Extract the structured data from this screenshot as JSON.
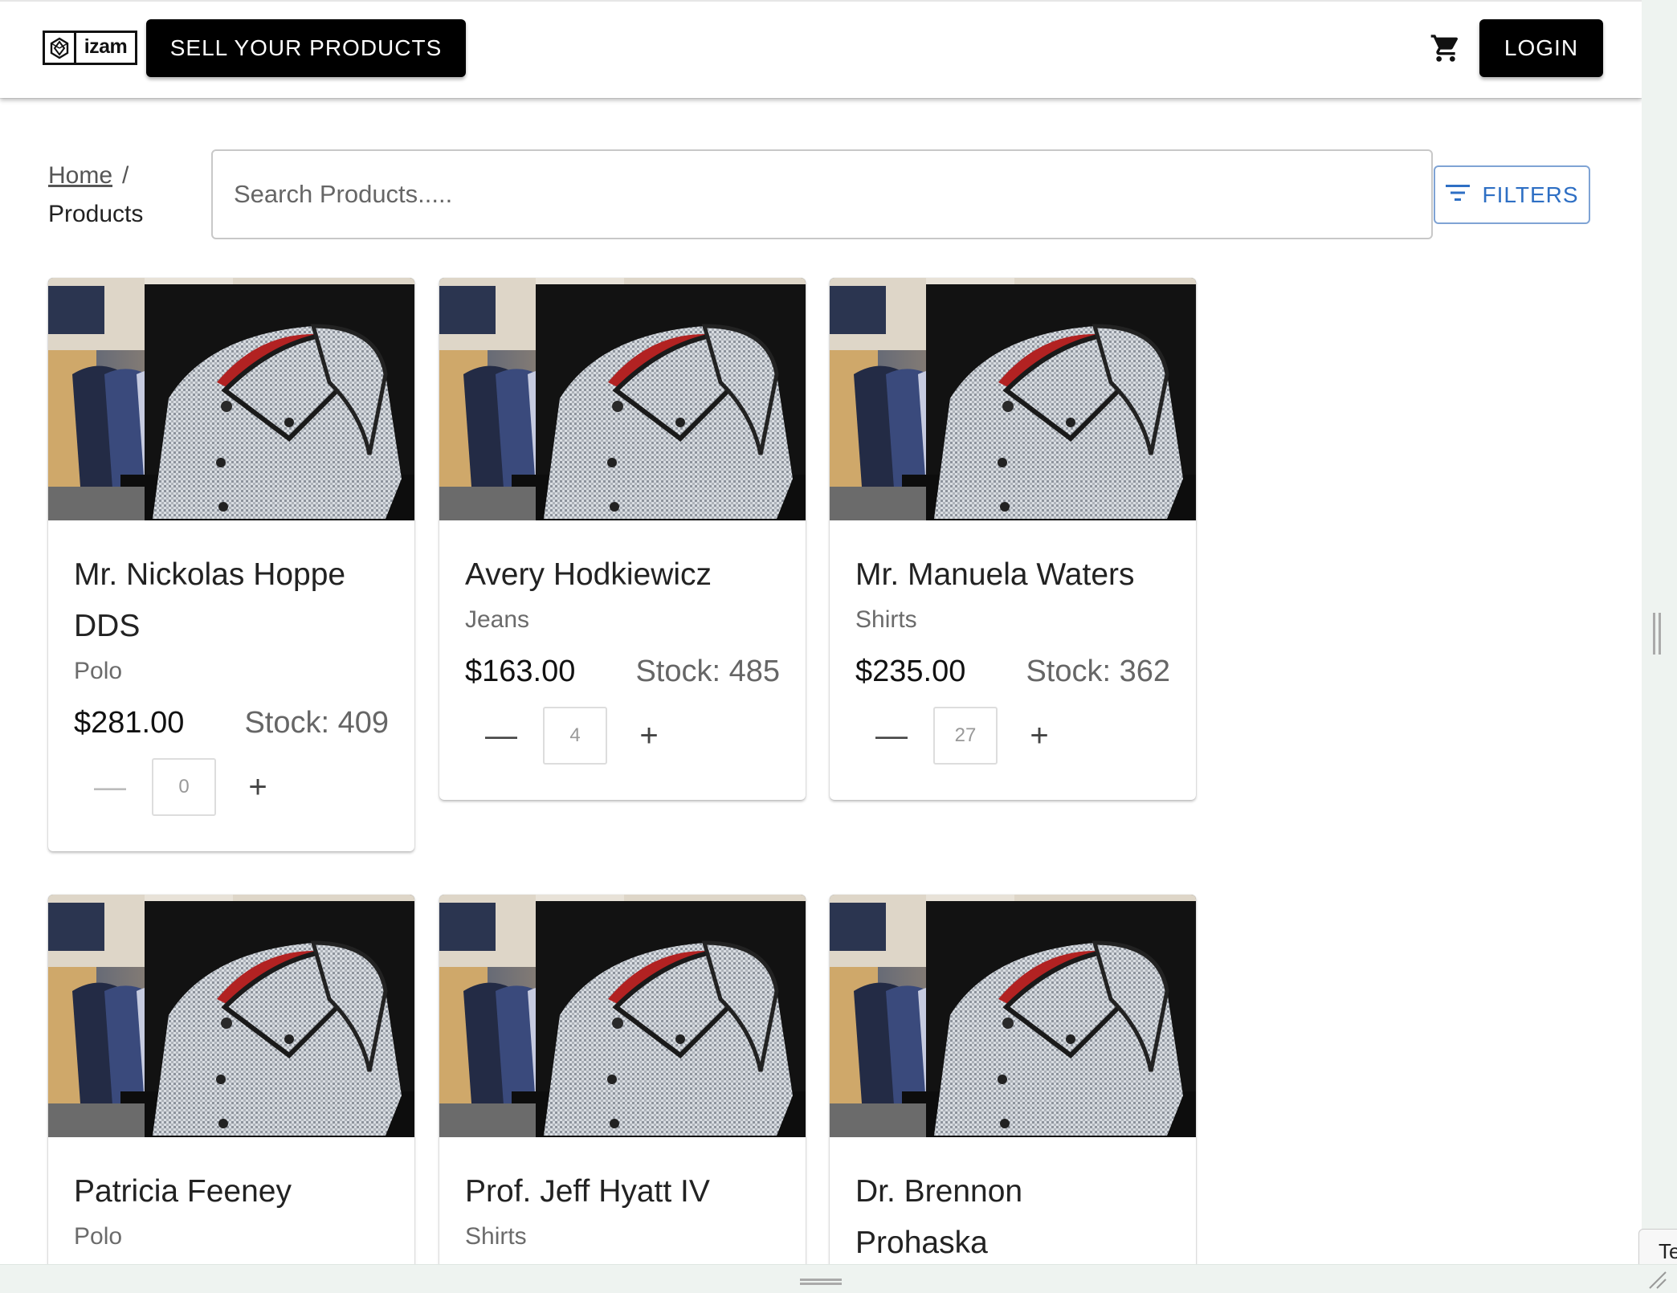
{
  "header": {
    "logo_text": "izam",
    "sell_label": "SELL YOUR PRODUCTS",
    "login_label": "LOGIN",
    "cart_icon": "shopping-cart-icon"
  },
  "breadcrumb": {
    "home": "Home",
    "separator": "/",
    "current": "Products"
  },
  "search": {
    "placeholder": "Search Products....."
  },
  "filters_label": "FILTERS",
  "products": [
    {
      "name": "Mr. Nickolas Hoppe DDS",
      "category": "Polo",
      "price": "$281.00",
      "stock": "Stock: 409",
      "qty": "0"
    },
    {
      "name": "Avery Hodkiewicz",
      "category": "Jeans",
      "price": "$163.00",
      "stock": "Stock: 485",
      "qty": "4"
    },
    {
      "name": "Mr. Manuela Waters",
      "category": "Shirts",
      "price": "$235.00",
      "stock": "Stock: 362",
      "qty": "27"
    },
    {
      "name": "Patricia Feeney",
      "category": "Polo"
    },
    {
      "name": "Prof. Jeff Hyatt IV",
      "category": "Shirts"
    },
    {
      "name": "Dr. Brennon Prohaska"
    }
  ],
  "corner_tab_text": "Te",
  "colors": {
    "accent": "#2e6fc4",
    "button_dark": "#000000",
    "page_bg": "#eef3f0"
  }
}
